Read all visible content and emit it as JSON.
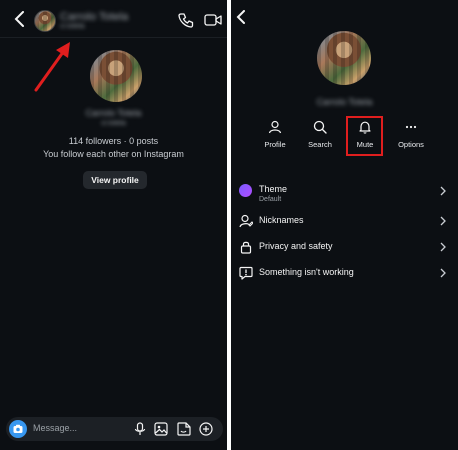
{
  "left": {
    "header": {
      "name": "Carrolo Totela",
      "subtext": "cr.totela"
    },
    "profile": {
      "name": "Carrolo Totela",
      "username": "cr.totela",
      "stats": "114 followers · 0 posts",
      "mutual": "You follow each other on Instagram",
      "view_profile_label": "View profile"
    },
    "composer": {
      "placeholder": "Message..."
    },
    "annotation_color": "#e01e1e"
  },
  "right": {
    "profile": {
      "name": "Carrolo Totela"
    },
    "actions": [
      {
        "label": "Profile",
        "icon": "person-icon"
      },
      {
        "label": "Search",
        "icon": "search-icon"
      },
      {
        "label": "Mute",
        "icon": "bell-icon"
      },
      {
        "label": "Options",
        "icon": "more-icon"
      }
    ],
    "menu": [
      {
        "label": "Theme",
        "sub": "Default",
        "icon": "theme-dot-icon"
      },
      {
        "label": "Nicknames",
        "icon": "person-tag-icon"
      },
      {
        "label": "Privacy and safety",
        "icon": "lock-icon"
      },
      {
        "label": "Something isn't working",
        "icon": "alert-icon"
      }
    ],
    "highlight_color": "#e01e1e",
    "theme_color": "#7b5cff"
  },
  "colors": {
    "background": "#0c0f13",
    "accent": "#3797f0"
  }
}
